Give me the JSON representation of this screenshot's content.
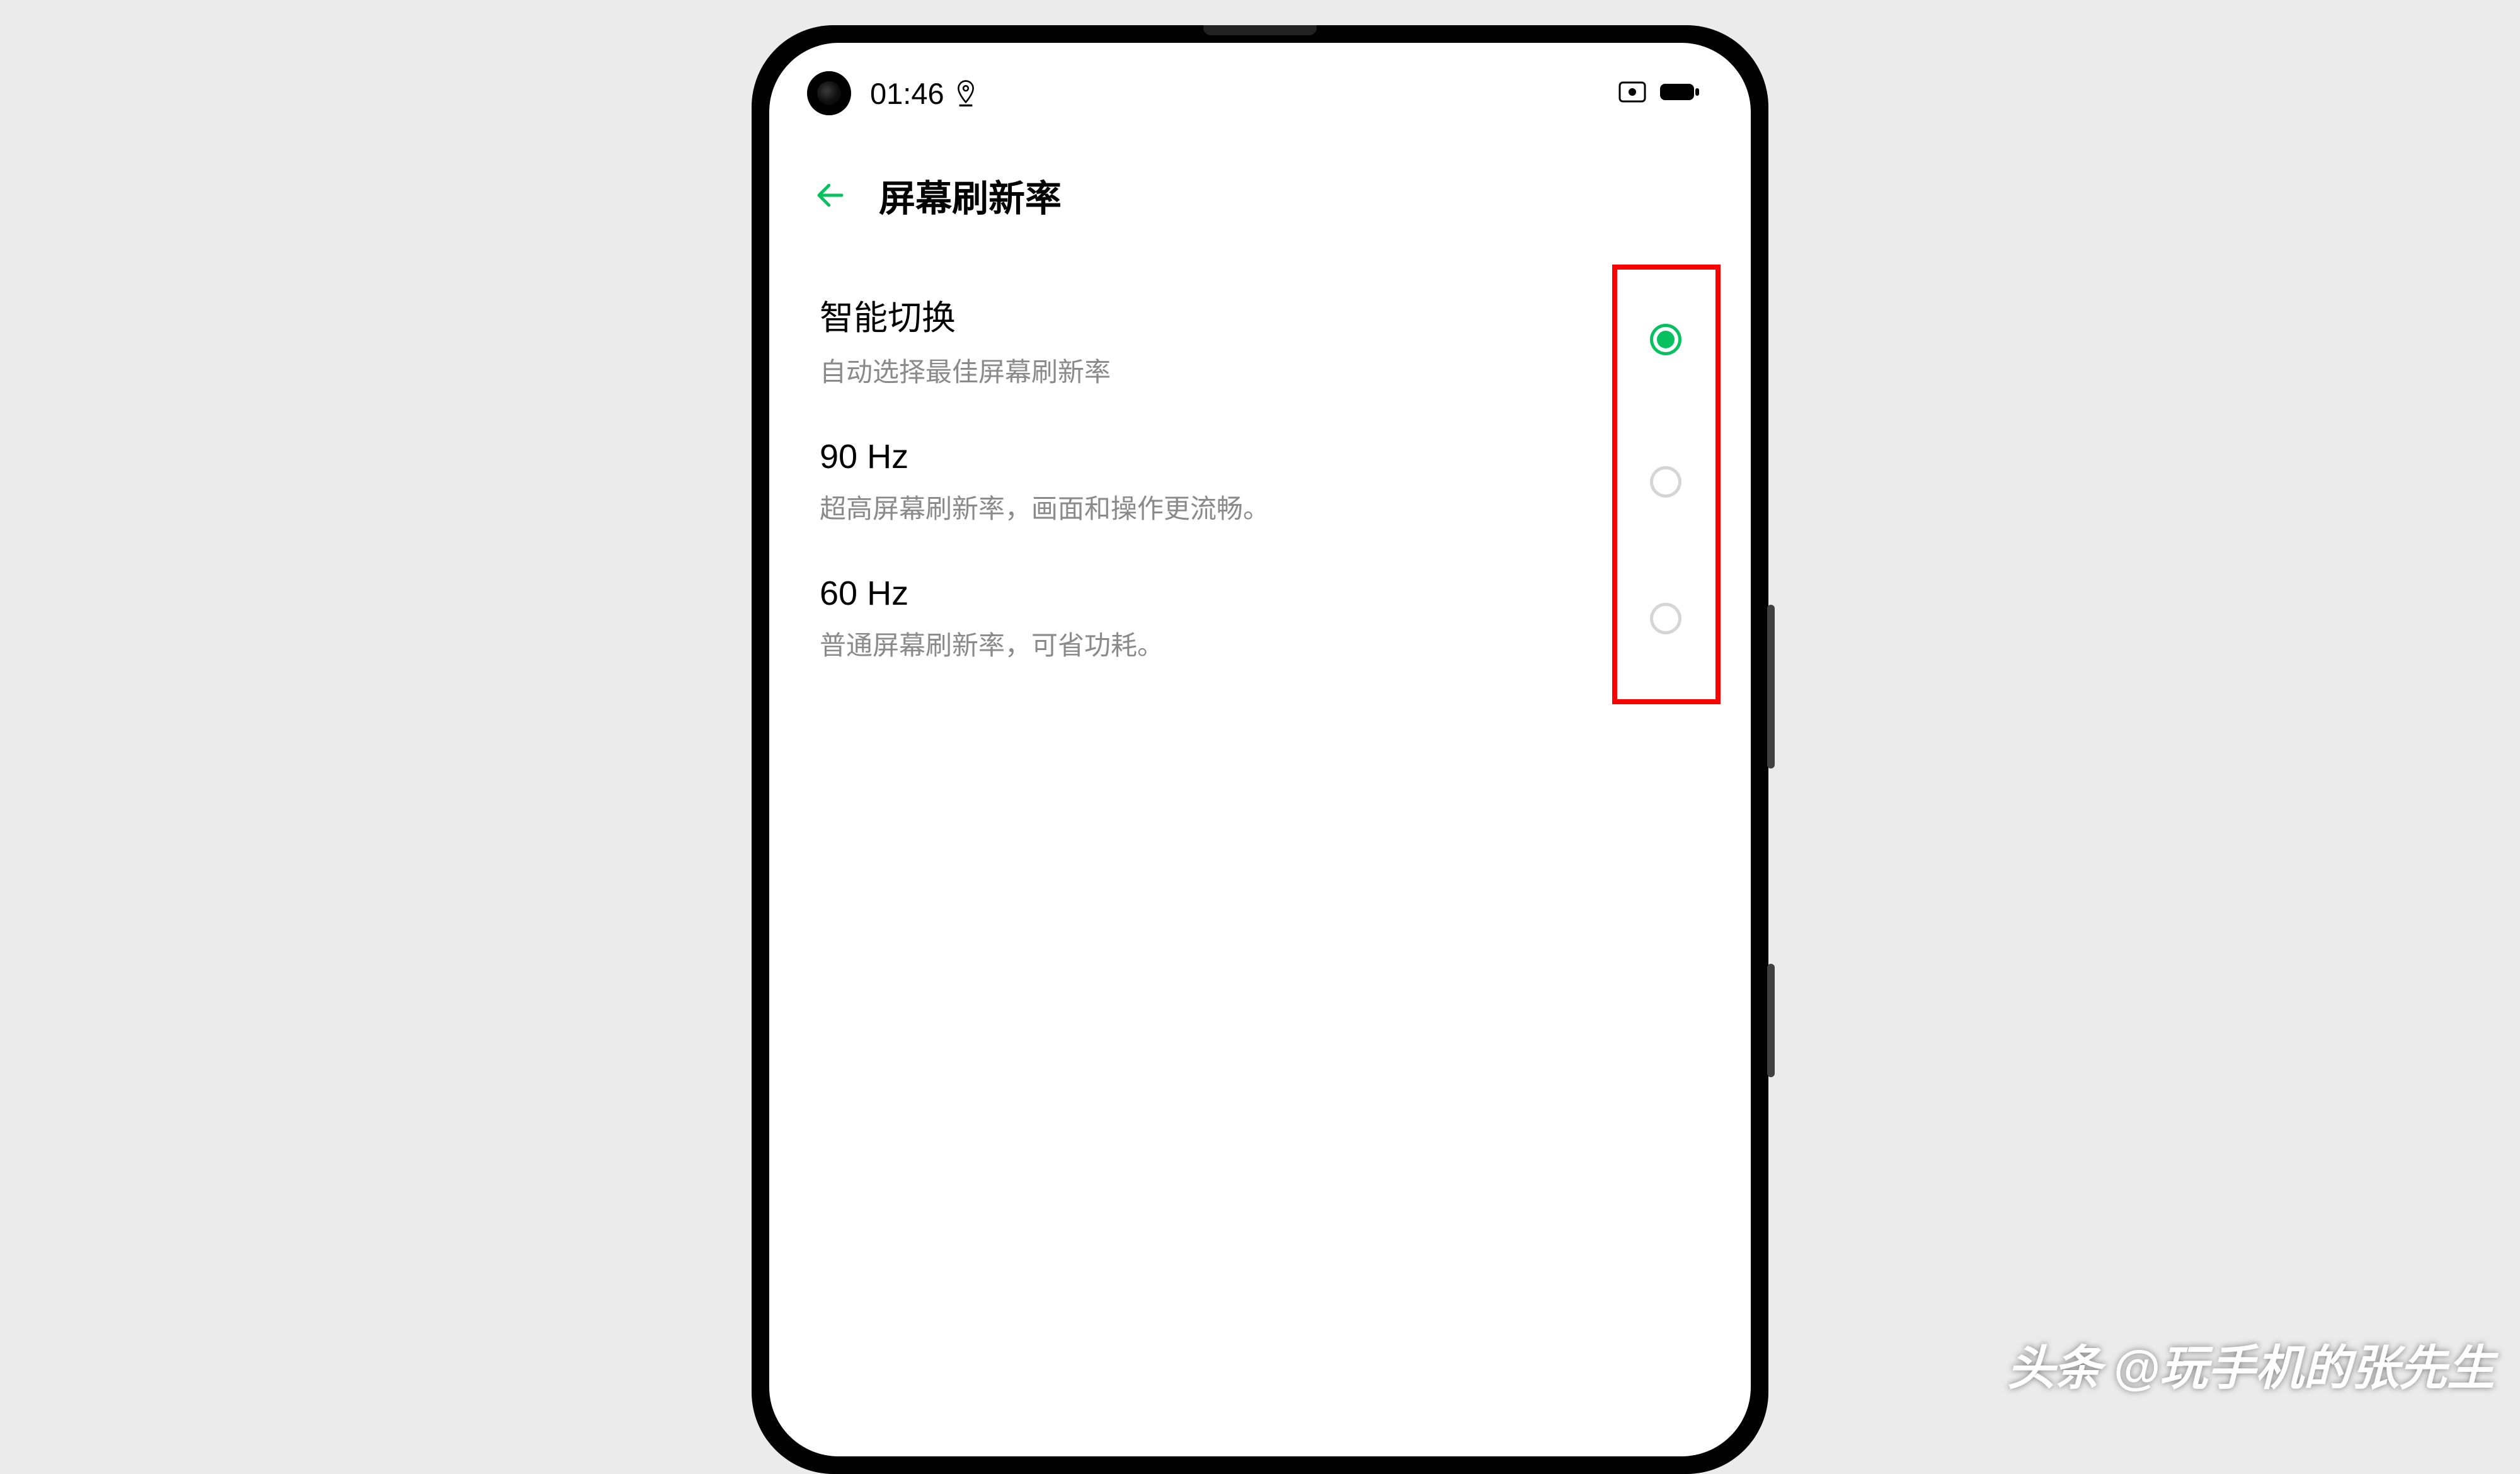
{
  "status_bar": {
    "time": "01:46"
  },
  "header": {
    "title": "屏幕刷新率"
  },
  "options": [
    {
      "title": "智能切换",
      "description": "自动选择最佳屏幕刷新率",
      "selected": true
    },
    {
      "title": "90 Hz",
      "description": "超高屏幕刷新率，画面和操作更流畅。",
      "selected": false
    },
    {
      "title": "60 Hz",
      "description": "普通屏幕刷新率，可省功耗。",
      "selected": false
    }
  ],
  "watermark": {
    "brand": "头条",
    "handle": "@玩手机的张先生"
  },
  "colors": {
    "accent": "#07c160",
    "highlight": "#ff0000"
  }
}
